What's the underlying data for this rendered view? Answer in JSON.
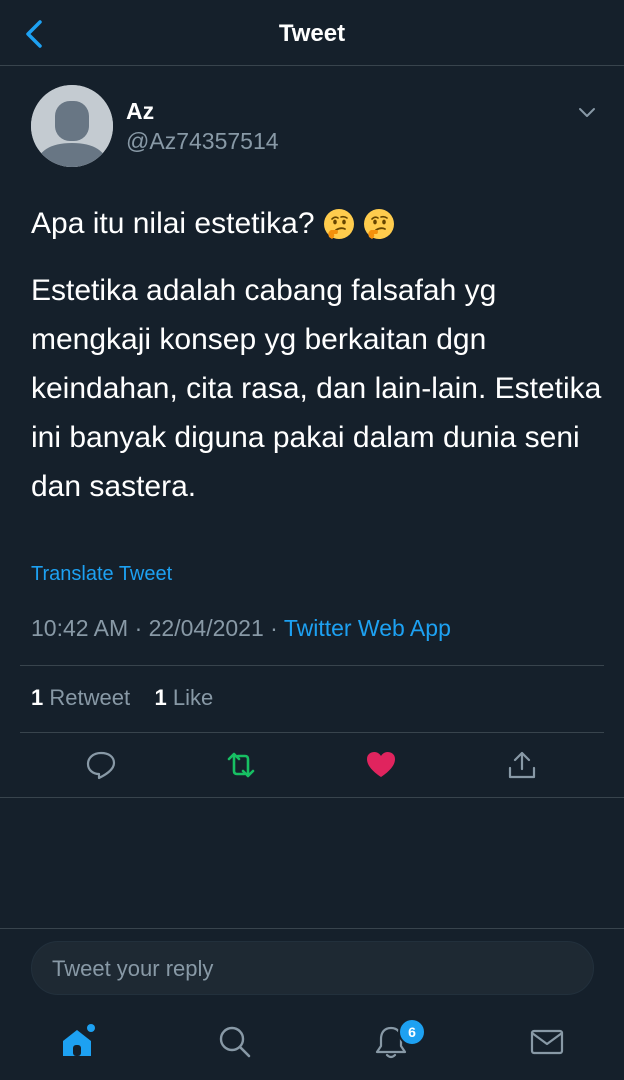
{
  "header": {
    "title": "Tweet"
  },
  "author": {
    "name": "Az",
    "handle": "@Az74357514"
  },
  "tweet": {
    "question": "Apa itu nilai estetika?",
    "emoji": [
      "thinking-face",
      "thinking-face"
    ],
    "body": "Estetika adalah cabang falsafah yg mengkaji konsep yg berkaitan dgn keindahan, cita rasa, dan lain-lain. Estetika ini banyak diguna pakai dalam dunia seni dan sastera.",
    "translate_label": "Translate Tweet",
    "time": "10:42 AM",
    "date": "22/04/2021",
    "separator": "·",
    "source": "Twitter Web App"
  },
  "stats": {
    "retweets_count": "1",
    "retweets_label": "Retweet",
    "likes_count": "1",
    "likes_label": "Like"
  },
  "actions": {
    "reply_icon": "reply-icon",
    "retweet_icon": "retweet-icon",
    "like_icon": "heart-icon",
    "share_icon": "share-icon"
  },
  "reply": {
    "placeholder": "Tweet your reply"
  },
  "tabbar": {
    "notifications_badge": "6",
    "items": [
      "home-icon",
      "search-icon",
      "notifications-icon",
      "messages-icon"
    ]
  },
  "colors": {
    "background": "#15202b",
    "accent": "#1da1f2",
    "secondary_text": "#8899a6",
    "retweet_active": "#17bf63",
    "like_active": "#e0245e",
    "divider": "#38444d"
  }
}
